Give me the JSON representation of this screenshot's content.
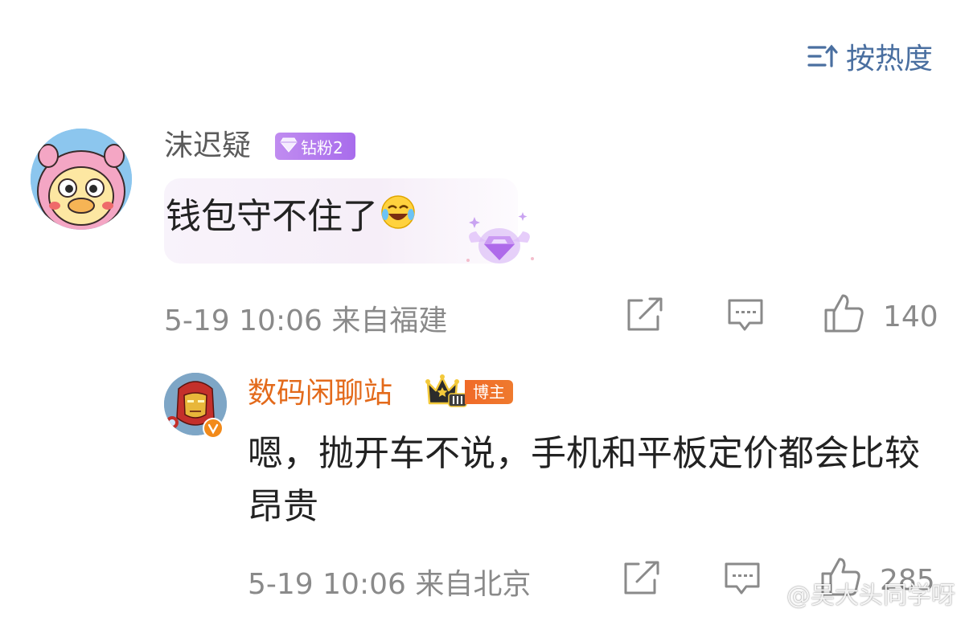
{
  "sort": {
    "label": "按热度",
    "icon": "sort-icon"
  },
  "comments": [
    {
      "username": "沫迟疑",
      "username_color": "#5b5b5b",
      "badge": {
        "icon": "diamond-icon",
        "label": "钻粉2"
      },
      "text": "钱包守不住了",
      "emoji": "laugh-cry-emoji",
      "bubble_decoration": "purple-gem-wings",
      "timestamp": "5-19 10:06",
      "location": "来自福建",
      "like_count": "140"
    },
    {
      "username": "数码闲聊站",
      "username_color": "#e36a1b",
      "badge": {
        "icon": "crown-level-icon",
        "label": "博主"
      },
      "verified": true,
      "text": "嗯，抛开车不说，手机和平板定价都会比较昂贵",
      "timestamp": "5-19 10:06",
      "location": "来自北京",
      "like_count": "285"
    }
  ],
  "watermark": "@吴大头同学呀",
  "colors": {
    "accent_blue": "#4a6fa0",
    "meta_gray": "#8a8a8a",
    "blogger_orange": "#e36a1b",
    "fan_purple": "#a86cec"
  }
}
